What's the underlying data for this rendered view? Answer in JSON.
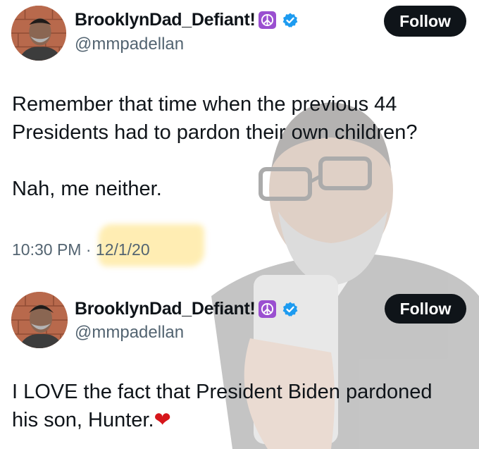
{
  "tweets": [
    {
      "display_name": "BrooklynDad_Defiant!",
      "handle": "@mmpadellan",
      "follow_label": "Follow",
      "text": "Remember that time when the previous 44\nPresidents had to pardon their own children?\n\nNah, me neither.",
      "time": "10:30 PM",
      "separator": "·",
      "date": "12/1/20"
    },
    {
      "display_name": "BrooklynDad_Defiant!",
      "handle": "@mmpadellan",
      "follow_label": "Follow",
      "text": "I LOVE the fact that President Biden pardoned\nhis son, Hunter.",
      "emoji": "❤"
    }
  ],
  "icons": {
    "badge": "peace-symbol-icon",
    "verified": "verified-check-icon",
    "emoji": "red-heart-icon"
  },
  "colors": {
    "text": "#0f1419",
    "secondary": "#536471",
    "verified_blue": "#1d9bf0",
    "follow_button": "#0f1419",
    "peace_purple": "#9a4fd0",
    "highlight": "#ffe89a",
    "heart": "#d6161b"
  }
}
